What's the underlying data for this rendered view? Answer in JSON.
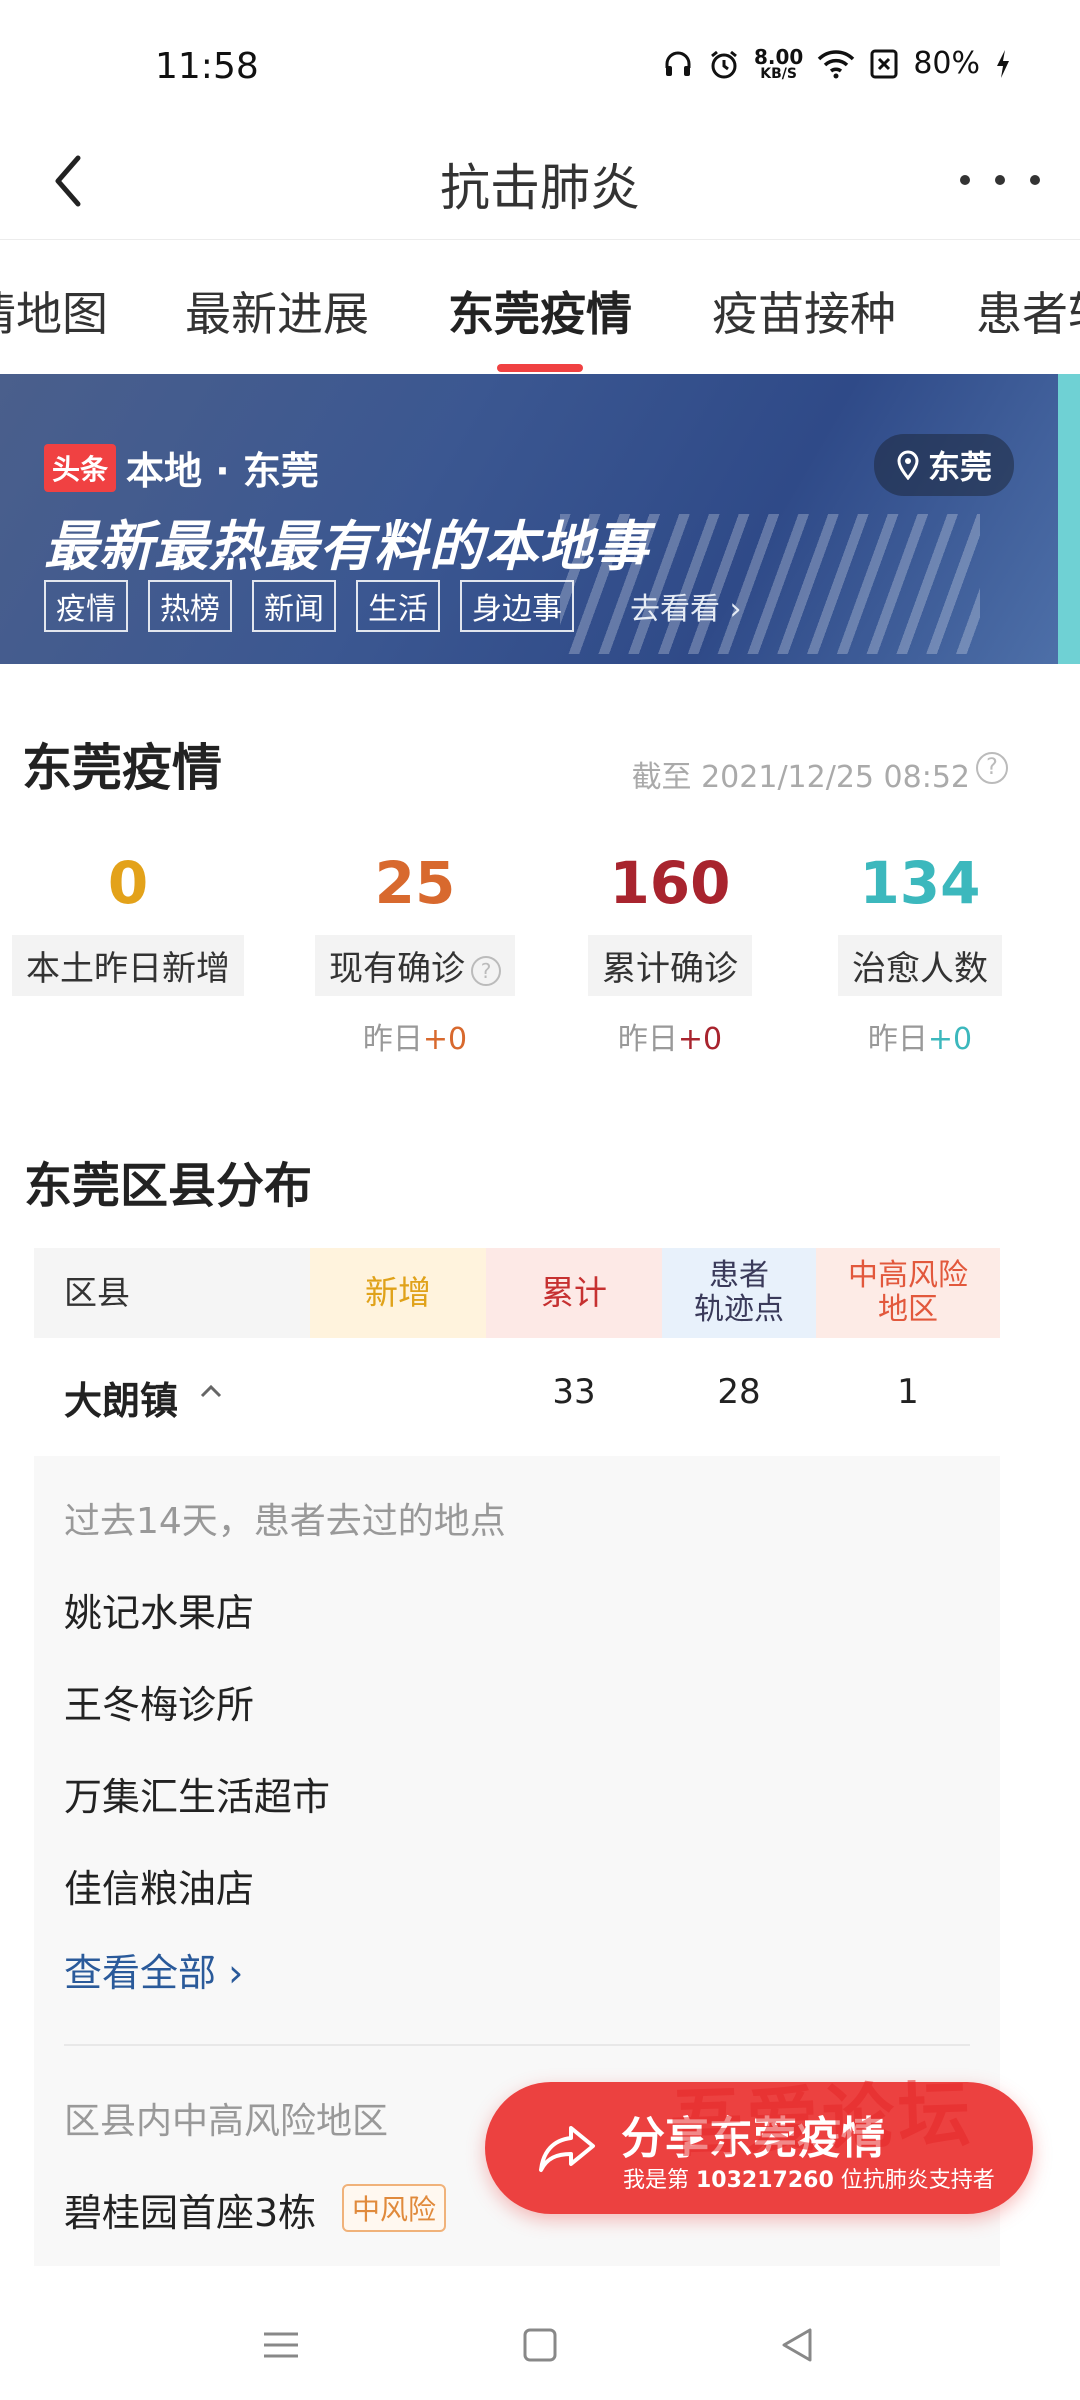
{
  "status_bar": {
    "time": "11:58",
    "net_speed_value": "8.00",
    "net_speed_unit": "KB/S",
    "battery": "80%",
    "icons": [
      "headphone-icon",
      "alarm-icon",
      "wifi-icon",
      "sim-off-icon",
      "charging-icon"
    ]
  },
  "header": {
    "title": "抗击肺炎"
  },
  "tabs": [
    {
      "label": "情地图"
    },
    {
      "label": "最新进展"
    },
    {
      "label": "东莞疫情",
      "active": true
    },
    {
      "label": "疫苗接种"
    },
    {
      "label": "患者轨"
    }
  ],
  "banner": {
    "logo": "头条",
    "brand": "本地 · 东莞",
    "location": "东莞",
    "slogan": "最新最热最有料的本地事",
    "tags": [
      "疫情",
      "热榜",
      "新闻",
      "生活",
      "身边事"
    ],
    "go_label": "去看看 ›"
  },
  "summary": {
    "title": "东莞疫情",
    "as_of": "截至 2021/12/25 08:52",
    "stats": [
      {
        "value": "0",
        "label": "本土昨日新增",
        "color": "#e3a21a"
      },
      {
        "value": "25",
        "label": "现有确诊",
        "delta_prefix": "昨日",
        "delta": "+0",
        "color": "#d8692e"
      },
      {
        "value": "160",
        "label": "累计确诊",
        "delta_prefix": "昨日",
        "delta": "+0",
        "color": "#a8242e"
      },
      {
        "value": "134",
        "label": "治愈人数",
        "delta_prefix": "昨日",
        "delta": "+0",
        "color": "#3cb8bd"
      }
    ]
  },
  "district": {
    "title": "东莞区县分布",
    "columns": [
      "区县",
      "新增",
      "累计",
      "患者\n轨迹点",
      "中高风险\n地区"
    ],
    "rows": [
      {
        "name": "大朗镇",
        "new": "",
        "total": "33",
        "trace": "28",
        "risk": "1"
      }
    ],
    "detail": {
      "hint": "过去14天，患者去过的地点",
      "places": [
        "姚记水果店",
        "王冬梅诊所",
        "万集汇生活超市",
        "佳信粮油店"
      ],
      "view_all": "查看全部 ›",
      "risk_title": "区县内中高风险地区",
      "risk_place": "碧桂园首座3栋",
      "risk_badge": "中风险"
    }
  },
  "share": {
    "title": "分享东莞疫情",
    "sub_prefix": "我是第 ",
    "sub_number": "103217260",
    "sub_suffix": " 位抗肺炎支持者"
  },
  "watermark": "吾爱论坛"
}
